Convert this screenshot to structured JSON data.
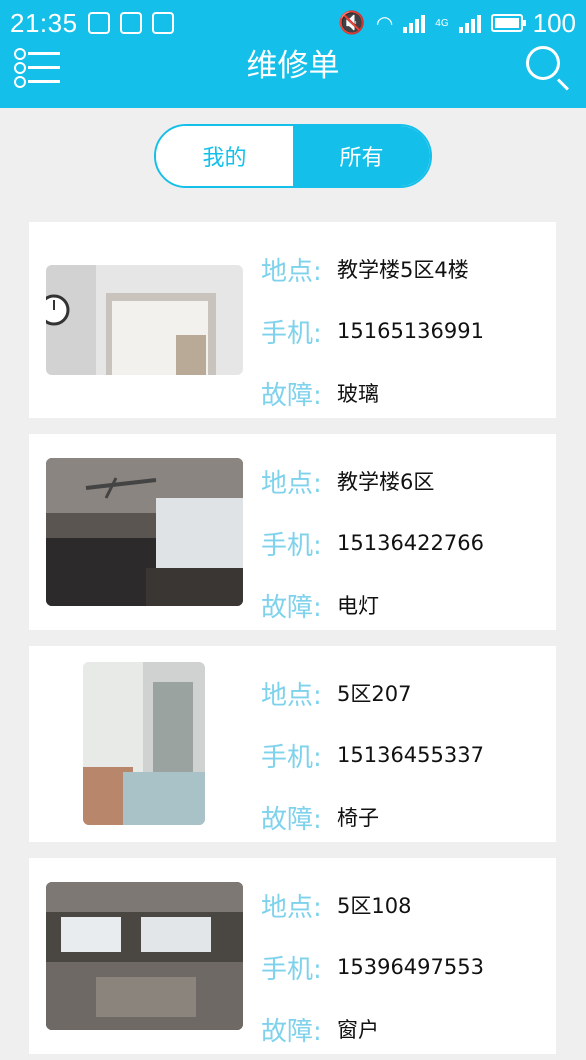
{
  "status_bar": {
    "time": "21:35",
    "battery": "100",
    "network": "4G"
  },
  "app_bar": {
    "title": "维修单",
    "menu_icon": "menu-list-icon",
    "search_icon": "search-icon"
  },
  "tabs": [
    {
      "label": "我的",
      "selected": false
    },
    {
      "label": "所有",
      "selected": true
    }
  ],
  "labels": {
    "location": "地点:",
    "phone": "手机:",
    "fault": "故障:"
  },
  "orders": [
    {
      "location": "教学楼5区4楼",
      "phone": "15165136991",
      "fault": "玻璃",
      "photo": "door-photo"
    },
    {
      "location": "教学楼6区",
      "phone": "15136422766",
      "fault": "电灯",
      "photo": "classroom-fan-photo"
    },
    {
      "location": "5区207",
      "phone": "15136455337",
      "fault": "椅子",
      "photo": "chair-photo"
    },
    {
      "location": "5区108",
      "phone": "15396497553",
      "fault": "窗户",
      "photo": "window-photo"
    }
  ],
  "colors": {
    "accent": "#14c0ea",
    "label": "#7fd2ec",
    "background": "#efefef"
  }
}
